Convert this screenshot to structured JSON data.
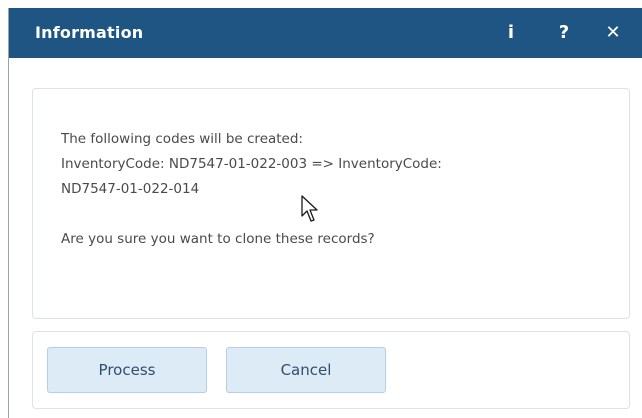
{
  "dialog": {
    "title": "Information",
    "titlebar_buttons": {
      "info_label": "i",
      "help_label": "?",
      "close_label": "✕"
    },
    "message": {
      "line1": "The following codes will be created:",
      "line2": "InventoryCode: ND7547-01-022-003 => InventoryCode:",
      "line3": "ND7547-01-022-014",
      "question": "Are you sure you want to clone these records?"
    },
    "buttons": {
      "process_label": "Process",
      "cancel_label": "Cancel"
    }
  },
  "colors": {
    "titlebar": "#1e5582",
    "button_bg": "#dcebf6",
    "text": "#4a4a4a"
  },
  "icons": {
    "info": "info-icon",
    "help": "help-icon",
    "close": "close-icon",
    "cursor": "mouse-pointer-icon"
  }
}
